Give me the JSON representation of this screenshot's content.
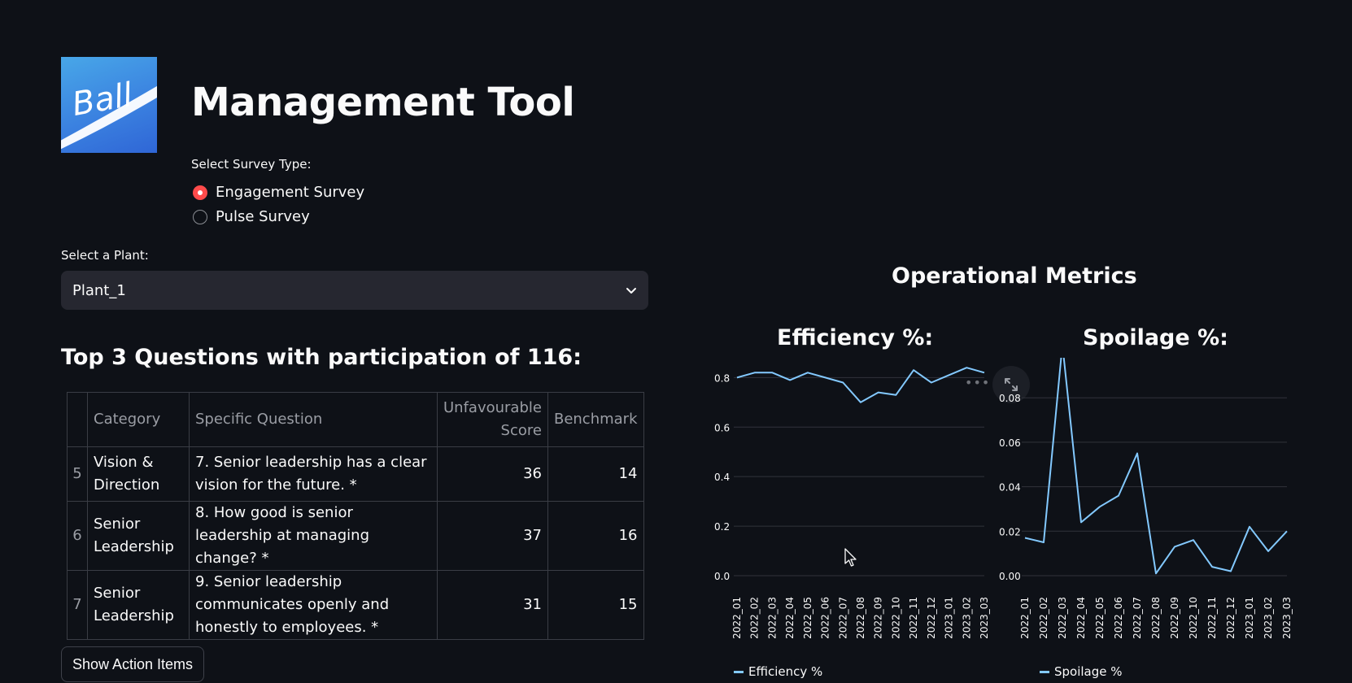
{
  "header": {
    "logo_text": "Ball",
    "title": "Management Tool"
  },
  "survey": {
    "label": "Select Survey Type:",
    "options": [
      "Engagement Survey",
      "Pulse Survey"
    ],
    "selected": "Engagement Survey"
  },
  "plant": {
    "label": "Select a Plant:",
    "value": "Plant_1"
  },
  "questions": {
    "heading": "Top 3 Questions with participation of 116:",
    "columns": [
      "",
      "Category",
      "Specific Question",
      "Unfavourable Score",
      "Benchmark"
    ],
    "rows": [
      {
        "index": "5",
        "category": "Vision & Direction",
        "question": "7. Senior leadership has a clear vision for the future. *",
        "score": "36",
        "benchmark": "14"
      },
      {
        "index": "6",
        "category": "Senior Leadership",
        "question": "8. How good is senior leadership at managing change? *",
        "score": "37",
        "benchmark": "16"
      },
      {
        "index": "7",
        "category": "Senior Leadership",
        "question": "9. Senior leadership communicates openly and honestly to employees. *",
        "score": "31",
        "benchmark": "15"
      }
    ]
  },
  "actions": {
    "button_label": "Show Action Items"
  },
  "operational": {
    "heading": "Operational Metrics"
  },
  "chart_data": [
    {
      "type": "line",
      "title": "Efficiency %:",
      "categories": [
        "2022_01",
        "2022_02",
        "2022_03",
        "2022_04",
        "2022_05",
        "2022_06",
        "2022_07",
        "2022_08",
        "2022_09",
        "2022_10",
        "2022_11",
        "2022_12",
        "2023_01",
        "2023_02",
        "2023_03"
      ],
      "series": [
        {
          "name": "Efficiency %",
          "values": [
            0.8,
            0.82,
            0.82,
            0.79,
            0.82,
            0.8,
            0.78,
            0.7,
            0.74,
            0.73,
            0.83,
            0.78,
            0.81,
            0.84,
            0.82
          ],
          "color": "#83c9ff"
        }
      ],
      "yticks": [
        "0.0",
        "0.2",
        "0.4",
        "0.6",
        "0.8"
      ],
      "ylim": [
        0,
        0.88
      ],
      "grid": true,
      "legend": "bottom-left"
    },
    {
      "type": "line",
      "title": "Spoilage %:",
      "categories": [
        "2022_01",
        "2022_02",
        "2022_03",
        "2022_04",
        "2022_05",
        "2022_06",
        "2022_07",
        "2022_08",
        "2022_09",
        "2022_10",
        "2022_11",
        "2022_12",
        "2023_01",
        "2023_02",
        "2023_03"
      ],
      "series": [
        {
          "name": "Spoilage %",
          "values": [
            0.017,
            0.015,
            0.104,
            0.024,
            0.031,
            0.036,
            0.055,
            0.001,
            0.013,
            0.016,
            0.004,
            0.002,
            0.022,
            0.011,
            0.02
          ],
          "color": "#83c9ff"
        }
      ],
      "yticks": [
        "0.00",
        "0.02",
        "0.04",
        "0.06",
        "0.08"
      ],
      "ylim": [
        0,
        0.098
      ],
      "grid": true,
      "legend": "bottom-left"
    }
  ]
}
